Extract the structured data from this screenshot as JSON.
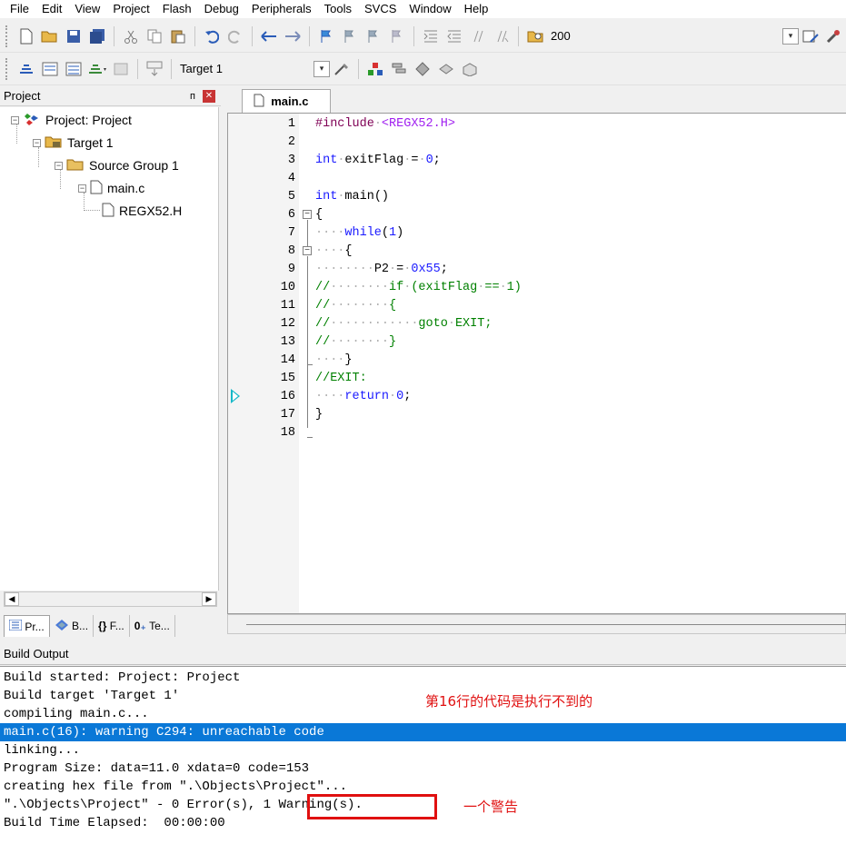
{
  "menu": [
    "File",
    "Edit",
    "View",
    "Project",
    "Flash",
    "Debug",
    "Peripherals",
    "Tools",
    "SVCS",
    "Window",
    "Help"
  ],
  "toolbar1": {
    "zoom_value": "200"
  },
  "toolbar2": {
    "target_name": "Target 1"
  },
  "project_pane": {
    "title": "Project",
    "tree": [
      {
        "label": "Project: Project"
      },
      {
        "label": "Target 1"
      },
      {
        "label": "Source Group 1"
      },
      {
        "label": "main.c"
      },
      {
        "label": "REGX52.H"
      }
    ],
    "tabs": [
      "Pr...",
      "B...",
      "F...",
      "Te..."
    ]
  },
  "editor": {
    "tab_label": "main.c",
    "line_numbers": [
      "1",
      "2",
      "3",
      "4",
      "5",
      "6",
      "7",
      "8",
      "9",
      "10",
      "11",
      "12",
      "13",
      "14",
      "15",
      "16",
      "17",
      "18"
    ],
    "current_line": "16"
  },
  "build_output": {
    "title": "Build Output",
    "lines": [
      "Build started: Project: Project",
      "Build target 'Target 1'",
      "compiling main.c...",
      "main.c(16): warning C294: unreachable code",
      "linking...",
      "Program Size: data=11.0 xdata=0 code=153",
      "creating hex file from \".\\Objects\\Project\"...",
      "\".\\Objects\\Project\" - 0 Error(s), 1 Warning(s).",
      "Build Time Elapsed:  00:00:00"
    ],
    "highlighted_index": 3
  },
  "annotations": {
    "line16_note": "第16行的代码是执行不到的",
    "warning_note": "一个警告"
  },
  "colors": {
    "highlight": "#0a78d7",
    "annotation": "#e01010",
    "keyword": "#1a1aff",
    "comment": "#008000"
  }
}
